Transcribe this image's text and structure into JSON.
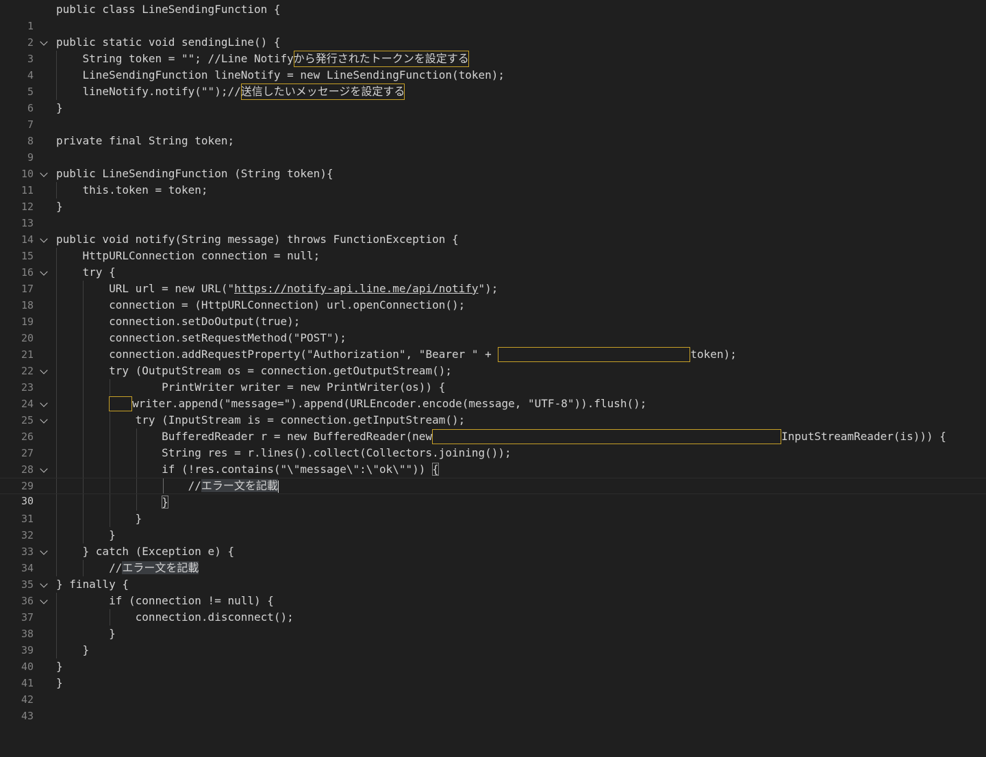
{
  "editor": {
    "active_line": 30,
    "lines": [
      {
        "n": "1",
        "t": "public class LineSendingFunction {"
      },
      {
        "n": "2",
        "t": ""
      },
      {
        "n": "3",
        "t": "public static void sendingLine() {"
      },
      {
        "n": "4",
        "a": "    String token = \"\"; //Line Notify",
        "h": "から発行されたトークンを設定する"
      },
      {
        "n": "5",
        "t": "    LineSendingFunction lineNotify = new LineSendingFunction(token);"
      },
      {
        "n": "6",
        "a": "    lineNotify.notify(\"\");//",
        "h": "送信したいメッセージを設定する"
      },
      {
        "n": "7",
        "t": "}"
      },
      {
        "n": "8",
        "t": ""
      },
      {
        "n": "9",
        "t": "private final String token;"
      },
      {
        "n": "10",
        "t": ""
      },
      {
        "n": "11",
        "t": "public LineSendingFunction (String token){"
      },
      {
        "n": "12",
        "t": "    this.token = token;"
      },
      {
        "n": "13",
        "t": "}"
      },
      {
        "n": "14",
        "t": ""
      },
      {
        "n": "15",
        "t": "public void notify(String message) throws FunctionException {"
      },
      {
        "n": "16",
        "t": "    HttpURLConnection connection = null;"
      },
      {
        "n": "17",
        "t": "    try {"
      },
      {
        "n": "18",
        "a": "        URL url = new URL(\"",
        "u": "https://notify-api.line.me/api/notify",
        "b": "\");"
      },
      {
        "n": "19",
        "t": "        connection = (HttpURLConnection) url.openConnection();"
      },
      {
        "n": "20",
        "t": "        connection.setDoOutput(true);"
      },
      {
        "n": "21",
        "t": "        connection.setRequestMethod(\"POST\");"
      },
      {
        "n": "22",
        "a": "        connection.addRequestProperty(\"Authorization\", \"Bearer \" + ",
        "b": "token);"
      },
      {
        "n": "23",
        "t": "        try (OutputStream os = connection.getOutputStream();"
      },
      {
        "n": "24",
        "t": "                PrintWriter writer = new PrintWriter(os)) {"
      },
      {
        "n": "25",
        "a": "        ",
        "b": "writer.append(\"message=\").append(URLEncoder.encode(message, \"UTF-8\")).flush();"
      },
      {
        "n": "26",
        "t": "            try (InputStream is = connection.getInputStream();"
      },
      {
        "n": "27",
        "a": "                BufferedReader r = new BufferedReader(new",
        "b": "InputStreamReader(is))) {"
      },
      {
        "n": "28",
        "t": "                String res = r.lines().collect(Collectors.joining());"
      },
      {
        "n": "29",
        "a": "                if (!res.contains(\"\\\"message\\\":\\\"ok\\\"\")) ",
        "k": "{"
      },
      {
        "n": "30",
        "a": "                    //",
        "s": "エラー文を記載"
      },
      {
        "n": "31",
        "a": "                ",
        "k": "}"
      },
      {
        "n": "32",
        "t": "            }"
      },
      {
        "n": "33",
        "t": "        }"
      },
      {
        "n": "34",
        "t": "    } catch (Exception e) {"
      },
      {
        "n": "35",
        "a": "        //",
        "s": "エラー文を記載"
      },
      {
        "n": "36",
        "t": "} finally {"
      },
      {
        "n": "37",
        "t": "        if (connection != null) {"
      },
      {
        "n": "38",
        "t": "            connection.disconnect();"
      },
      {
        "n": "39",
        "t": "        }"
      },
      {
        "n": "40",
        "t": "    }"
      },
      {
        "n": "41",
        "t": "}"
      },
      {
        "n": "42",
        "t": "}"
      },
      {
        "n": "43",
        "t": ""
      }
    ]
  }
}
